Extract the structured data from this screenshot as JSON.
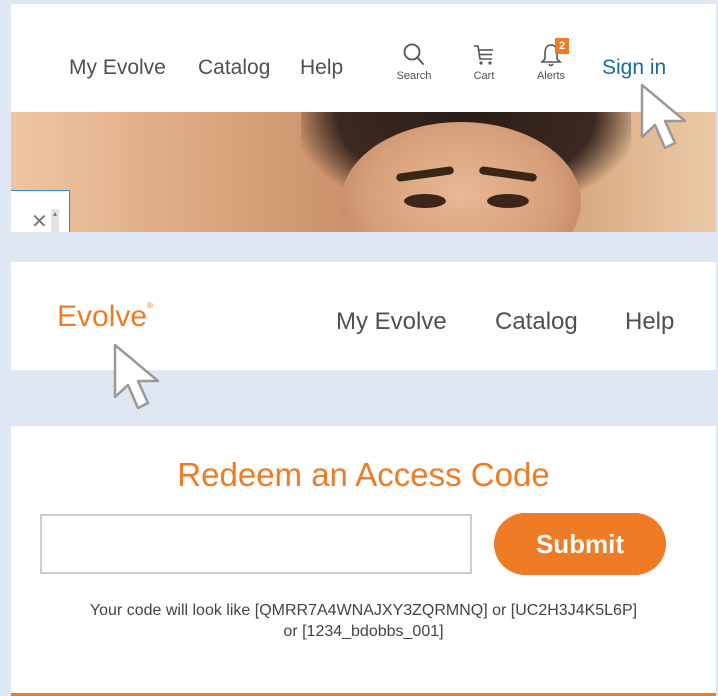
{
  "panel1": {
    "nav": {
      "my_evolve": "My Evolve",
      "catalog": "Catalog",
      "help": "Help",
      "search_caption": "Search",
      "cart_caption": "Cart",
      "alerts_caption": "Alerts",
      "alerts_count": "2",
      "sign_in": "Sign in"
    },
    "icons": [
      "search-icon",
      "cart-icon",
      "bell-icon",
      "close-icon",
      "mouse-cursor-icon"
    ]
  },
  "panel2": {
    "logo": "Evolve",
    "logo_mark": "®",
    "nav": {
      "my_evolve": "My Evolve",
      "catalog": "Catalog",
      "help": "Help"
    }
  },
  "panel3": {
    "title": "Redeem an Access Code",
    "input_value": "",
    "submit_label": "Submit",
    "hint_line1": "Your code will look like [QMRR7A4WNAJXY3ZQRMNQ] or [UC2H3J4K5L6P]",
    "hint_line2": "or [1234_bdobbs_001]"
  },
  "colors": {
    "brand_orange": "#ef7b25",
    "link_blue": "#1769a6",
    "background": "#dfe7f2"
  }
}
